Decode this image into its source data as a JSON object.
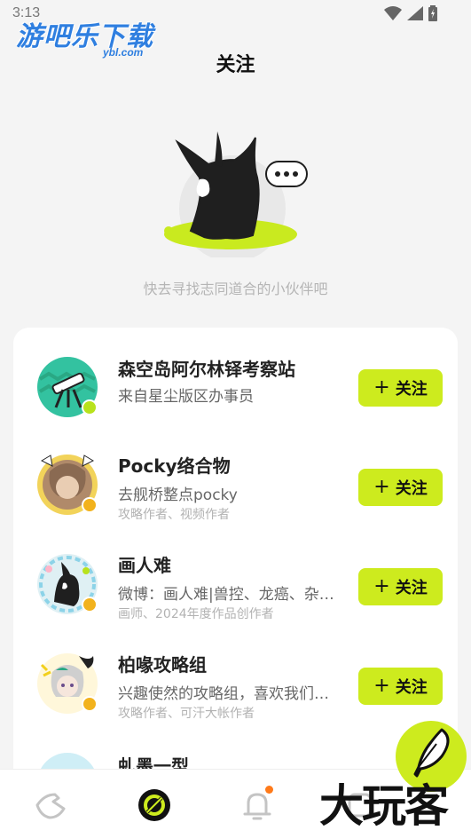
{
  "status_bar": {
    "time": "3:13"
  },
  "watermark": {
    "top_main": "游吧乐下载",
    "top_sub": "ybl.com",
    "bottom": "大玩客"
  },
  "header": {
    "title": "关注"
  },
  "empty_state": {
    "text": "快去寻找志同道合的小伙伴吧"
  },
  "recommendations": [
    {
      "name": "森空岛阿尔林铎考察站",
      "desc": "来自星尘版区办事员",
      "tags": "",
      "follow_label": "关注"
    },
    {
      "name": "Pocky络合物",
      "desc": "去舰桥整点pocky",
      "tags": "攻略作者、视频作者",
      "follow_label": "关注"
    },
    {
      "name": "画人难",
      "desc": "微博：画人难|兽控、龙癌、杂…",
      "tags": "画师、2024年度作品创作者",
      "follow_label": "关注"
    },
    {
      "name": "柏喙攻略组",
      "desc": "兴趣使然的攻略组，喜欢我们…",
      "tags": "攻略作者、可汗大帐作者",
      "follow_label": "关注"
    },
    {
      "name": "虬墨一型",
      "desc": "",
      "tags": "",
      "follow_label": ""
    }
  ],
  "colors": {
    "accent": "#cdeb1e",
    "background": "#f4f4f4",
    "notif_dot": "#ff7a1a",
    "brand_blue": "#2f7fe0"
  },
  "bottom_nav": {
    "items": [
      {
        "icon": "home-icon"
      },
      {
        "icon": "follow-icon",
        "active": true
      },
      {
        "icon": "bell-icon",
        "has_dot": true
      },
      {
        "icon": "profile-icon"
      }
    ]
  }
}
